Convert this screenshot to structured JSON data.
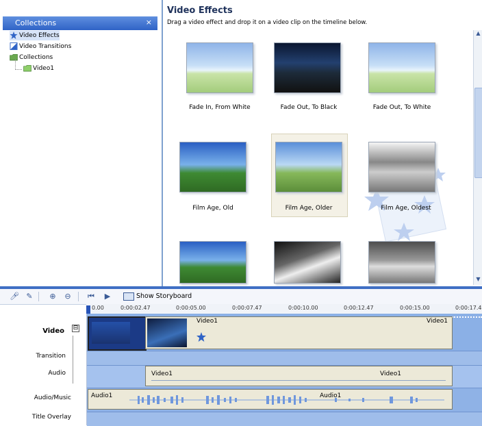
{
  "collections_pane": {
    "title": "Collections",
    "close": "×",
    "items": [
      {
        "label": "Video Effects",
        "icon": "star-icon",
        "selected": true
      },
      {
        "label": "Video Transitions",
        "icon": "transition-icon",
        "selected": false
      },
      {
        "label": "Collections",
        "icon": "folder-icon",
        "selected": false
      },
      {
        "label": "Video1",
        "icon": "folder-icon",
        "selected": false
      }
    ]
  },
  "effects_pane": {
    "title": "Video Effects",
    "subtitle": "Drag a video effect and drop it on a video clip on the timeline below.",
    "effects": [
      {
        "label": "Fade In, From White"
      },
      {
        "label": "Fade Out, To Black"
      },
      {
        "label": "Fade Out, To White"
      },
      {
        "label": "Film Age, Old"
      },
      {
        "label": "Film Age, Older",
        "selected": true
      },
      {
        "label": "Film Age, Oldest"
      }
    ]
  },
  "timeline": {
    "show_storyboard": "Show Storyboard",
    "ruler_ticks": [
      "0.00",
      "0:00:02.47",
      "0:00:05.00",
      "0:00:07.47",
      "0:00:10.00",
      "0:00:12.47",
      "0:00:15.00",
      "0:00:17.4"
    ],
    "tracks": {
      "video": "Video",
      "video_toggle": "⊟",
      "transition": "Transition",
      "audio": "Audio",
      "audio_music": "Audio/Music",
      "title_overlay": "Title Overlay"
    },
    "clips": {
      "video_clip": "Video1",
      "video_clip_end": "Video1",
      "audio_clip": "Video1",
      "audio_clip_end": "Video1",
      "music_clip": "Audio1",
      "music_clip_mid": "Audio1"
    }
  },
  "colors": {
    "accent": "#2f63c6",
    "track_bg": "#8bb0e6",
    "clip_bg": "#ece9d8"
  }
}
